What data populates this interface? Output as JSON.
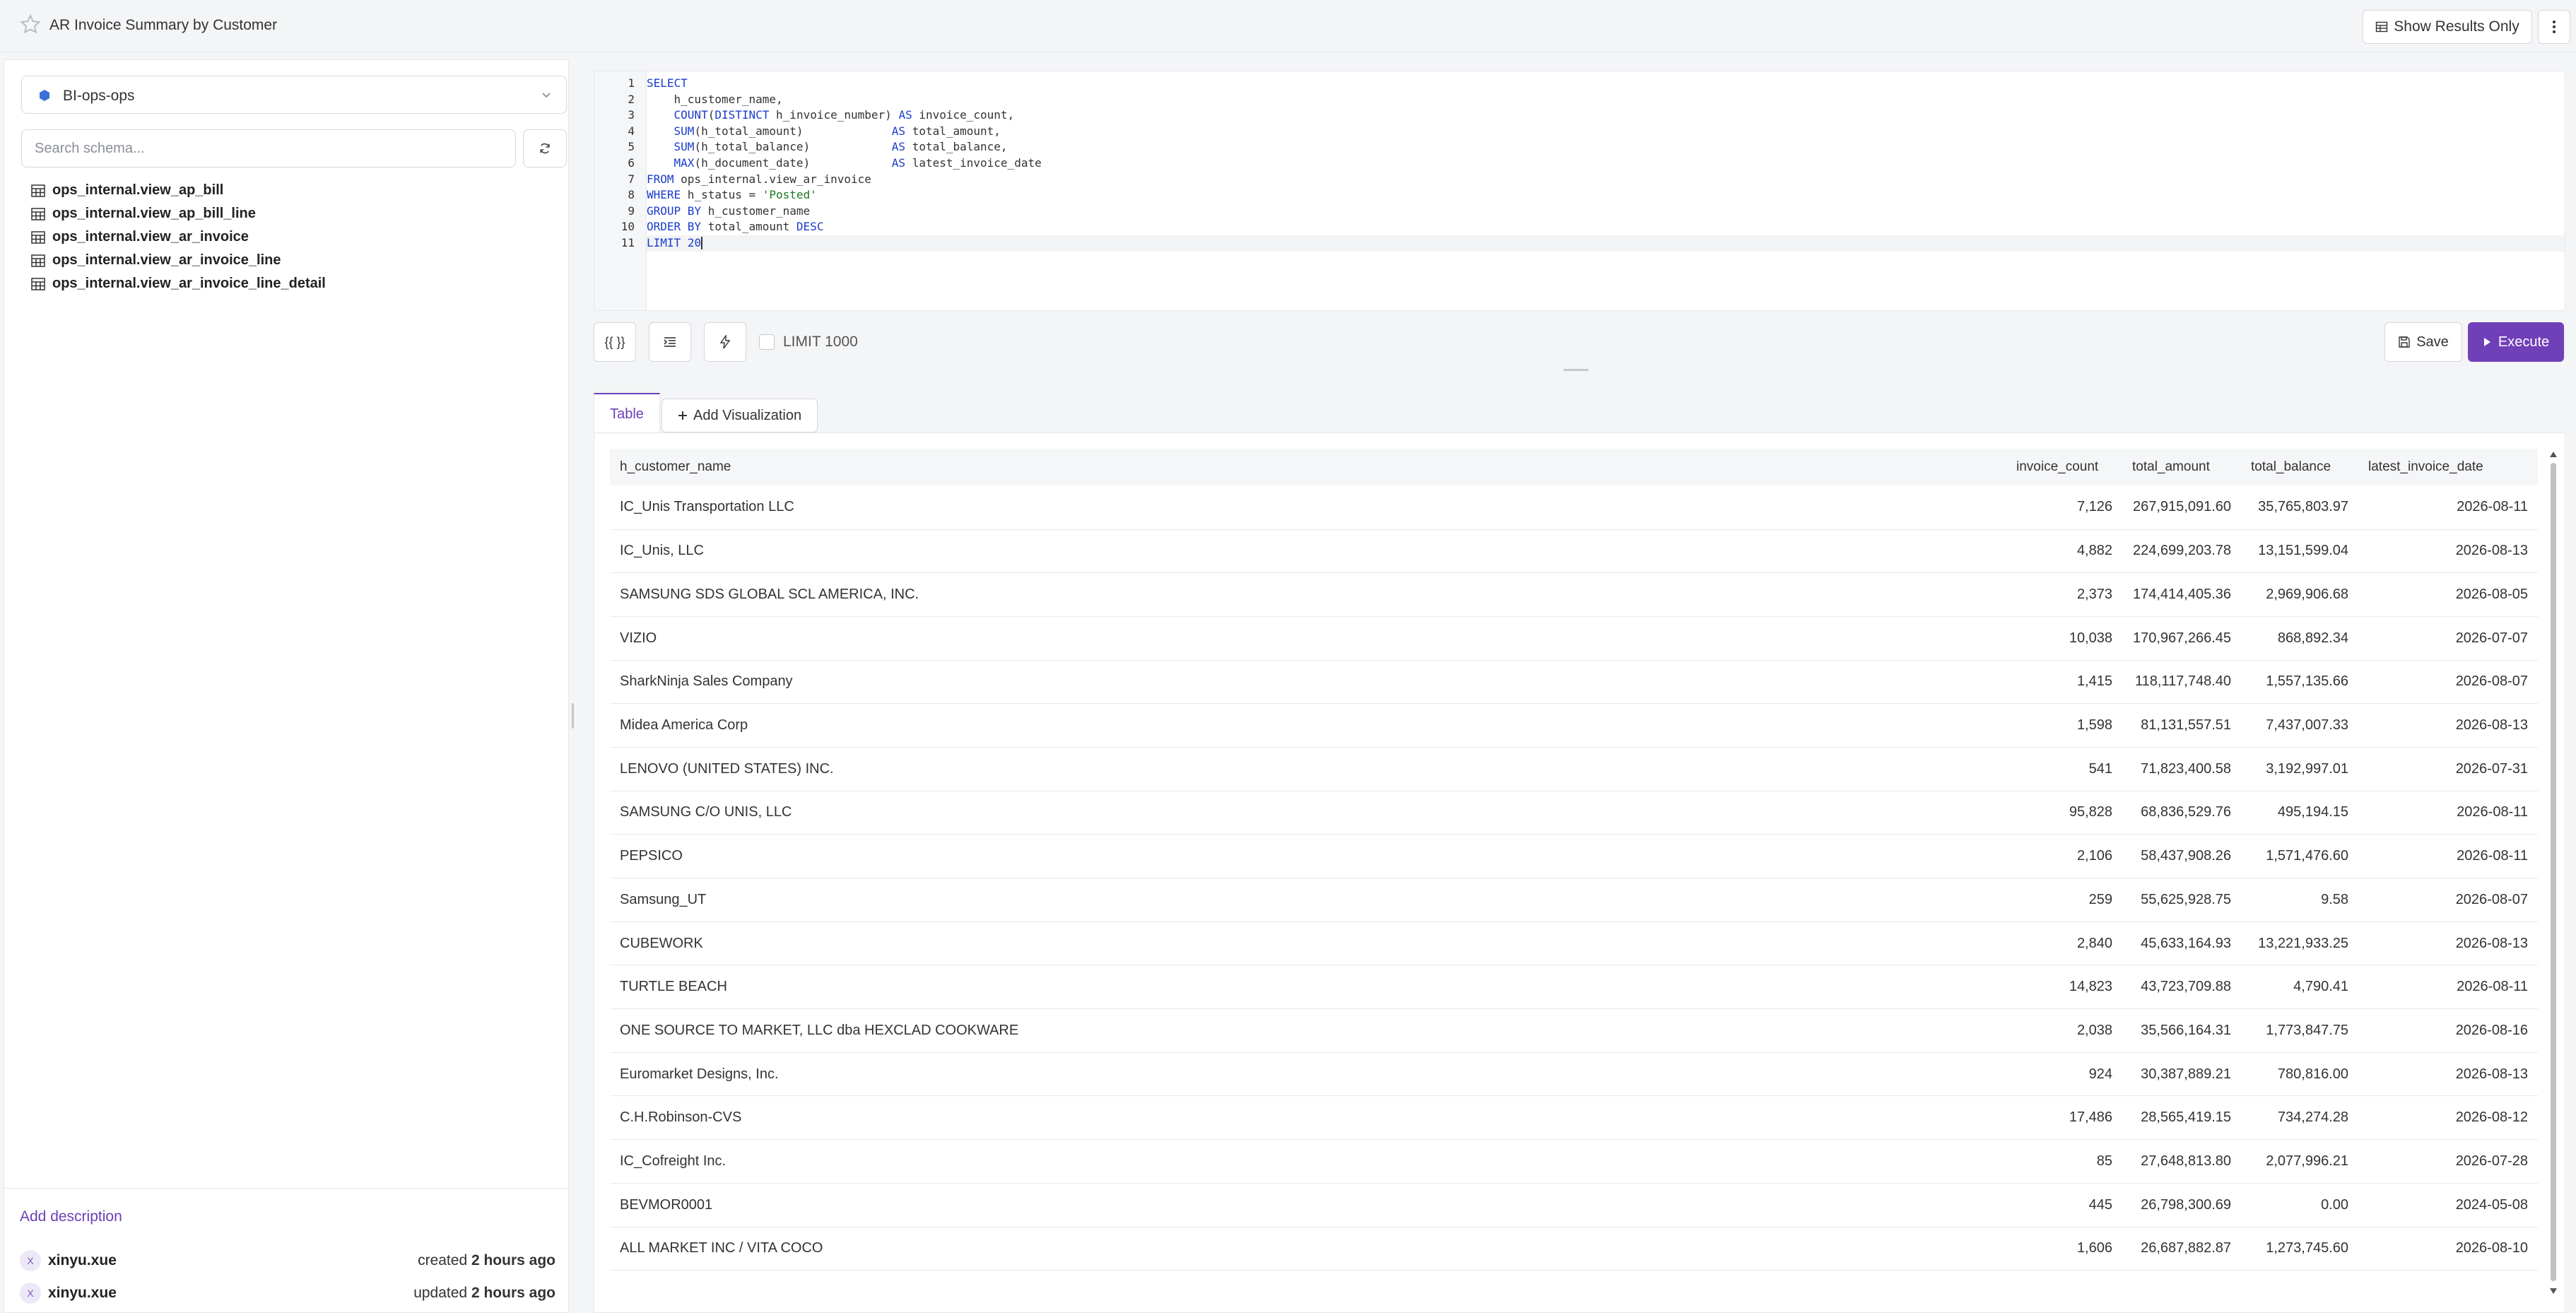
{
  "header": {
    "title": "AR Invoice Summary by Customer",
    "show_results_label": "Show Results Only"
  },
  "sidebar": {
    "datasource": "BI-ops-ops",
    "search_placeholder": "Search schema...",
    "tables": [
      "ops_internal.view_ap_bill",
      "ops_internal.view_ap_bill_line",
      "ops_internal.view_ar_invoice",
      "ops_internal.view_ar_invoice_line",
      "ops_internal.view_ar_invoice_line_detail"
    ],
    "add_description": "Add description",
    "created": {
      "avatar": "X",
      "user": "xinyu.xue",
      "action": "created",
      "when": "2 hours ago"
    },
    "updated": {
      "avatar": "X",
      "user": "xinyu.xue",
      "action": "updated",
      "when": "2 hours ago"
    }
  },
  "editor": {
    "line_numbers": [
      "1",
      "2",
      "3",
      "4",
      "5",
      "6",
      "7",
      "8",
      "9",
      "10",
      "11"
    ]
  },
  "toolbar": {
    "format_label": "{{ }}",
    "limit_label": "LIMIT 1000",
    "save_label": "Save",
    "execute_label": "Execute"
  },
  "results": {
    "tab_table": "Table",
    "add_visualization": "Add Visualization",
    "columns": [
      "h_customer_name",
      "invoice_count",
      "total_amount",
      "total_balance",
      "latest_invoice_date"
    ],
    "rows": [
      [
        "IC_Unis Transportation LLC",
        "7,126",
        "267,915,091.60",
        "35,765,803.97",
        "2026-08-11"
      ],
      [
        "IC_Unis, LLC",
        "4,882",
        "224,699,203.78",
        "13,151,599.04",
        "2026-08-13"
      ],
      [
        "SAMSUNG SDS GLOBAL SCL AMERICA, INC.",
        "2,373",
        "174,414,405.36",
        "2,969,906.68",
        "2026-08-05"
      ],
      [
        "VIZIO",
        "10,038",
        "170,967,266.45",
        "868,892.34",
        "2026-07-07"
      ],
      [
        "SharkNinja Sales Company",
        "1,415",
        "118,117,748.40",
        "1,557,135.66",
        "2026-08-07"
      ],
      [
        "Midea America Corp",
        "1,598",
        "81,131,557.51",
        "7,437,007.33",
        "2026-08-13"
      ],
      [
        "LENOVO (UNITED STATES) INC.",
        "541",
        "71,823,400.58",
        "3,192,997.01",
        "2026-07-31"
      ],
      [
        "SAMSUNG C/O UNIS, LLC",
        "95,828",
        "68,836,529.76",
        "495,194.15",
        "2026-08-11"
      ],
      [
        "PEPSICO",
        "2,106",
        "58,437,908.26",
        "1,571,476.60",
        "2026-08-11"
      ],
      [
        "Samsung_UT",
        "259",
        "55,625,928.75",
        "9.58",
        "2026-08-07"
      ],
      [
        "CUBEWORK",
        "2,840",
        "45,633,164.93",
        "13,221,933.25",
        "2026-08-13"
      ],
      [
        "TURTLE BEACH",
        "14,823",
        "43,723,709.88",
        "4,790.41",
        "2026-08-11"
      ],
      [
        "ONE SOURCE TO MARKET, LLC dba HEXCLAD COOKWARE",
        "2,038",
        "35,566,164.31",
        "1,773,847.75",
        "2026-08-16"
      ],
      [
        "Euromarket Designs, Inc.",
        "924",
        "30,387,889.21",
        "780,816.00",
        "2026-08-13"
      ],
      [
        "C.H.Robinson-CVS",
        "17,486",
        "28,565,419.15",
        "734,274.28",
        "2026-08-12"
      ],
      [
        "IC_Cofreight Inc.",
        "85",
        "27,648,813.80",
        "2,077,996.21",
        "2026-07-28"
      ],
      [
        "BEVMOR0001",
        "445",
        "26,798,300.69",
        "0.00",
        "2024-05-08"
      ],
      [
        "ALL MARKET INC / VITA COCO",
        "1,606",
        "26,687,882.87",
        "1,273,745.60",
        "2026-08-10"
      ]
    ]
  }
}
